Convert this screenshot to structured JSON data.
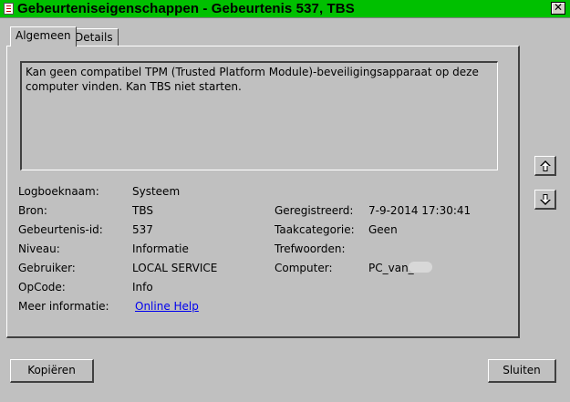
{
  "window": {
    "title": "Gebeurteniseigenschappen - Gebeurtenis 537, TBS",
    "close_glyph": "✕"
  },
  "tabs": [
    {
      "label": "Algemeen",
      "active": true
    },
    {
      "label": "Details",
      "active": false
    }
  ],
  "description": "Kan geen compatibel TPM (Trusted Platform Module)-beveiligingsapparaat op deze computer vinden. Kan TBS niet starten.",
  "fields": {
    "logboeknaam": {
      "label": "Logboeknaam:",
      "value": "Systeem"
    },
    "bron": {
      "label": "Bron:",
      "value": "TBS"
    },
    "gebeurtenis_id": {
      "label": "Gebeurtenis-id:",
      "value": "537"
    },
    "niveau": {
      "label": "Niveau:",
      "value": "Informatie"
    },
    "gebruiker": {
      "label": "Gebruiker:",
      "value": "LOCAL SERVICE"
    },
    "opcode": {
      "label": "OpCode:",
      "value": "Info"
    },
    "meer_informatie": {
      "label": "Meer informatie:",
      "value": "Online Help"
    },
    "geregistreerd": {
      "label": "Geregistreerd:",
      "value": "7-9-2014 17:30:41"
    },
    "taakcategorie": {
      "label": "Taakcategorie:",
      "value": "Geen"
    },
    "trefwoorden": {
      "label": "Trefwoorden:",
      "value": ""
    },
    "computer": {
      "label": "Computer:",
      "value": "PC_van_"
    }
  },
  "buttons": {
    "copy": "Kopiëren",
    "close": "Sluiten"
  },
  "icons": {
    "up": "arrow-up-icon",
    "down": "arrow-down-icon"
  }
}
